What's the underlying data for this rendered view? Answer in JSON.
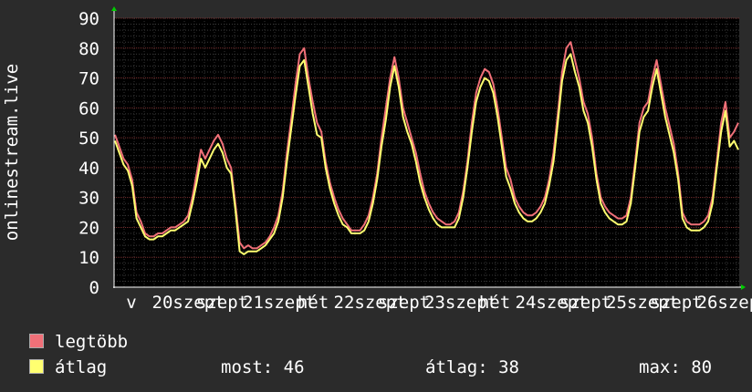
{
  "chart_data": {
    "type": "line",
    "ylabel": "onlinestream.live",
    "ylim": [
      0,
      90
    ],
    "y_ticks": [
      0,
      10,
      20,
      30,
      40,
      50,
      60,
      70,
      80,
      90
    ],
    "x_tick_labels": [
      "v",
      "20",
      "szept",
      "szept",
      "21",
      "szept",
      "hét",
      "22",
      "szept",
      "szept",
      "23",
      "szept",
      "hét",
      "24",
      "szept",
      "szept",
      "25",
      "szept",
      "szept",
      "26",
      "szept"
    ],
    "grid": true,
    "series": [
      {
        "name": "legtöbb",
        "color": "#f07078",
        "values": [
          51,
          47,
          43,
          41,
          36,
          25,
          22,
          18,
          17,
          17,
          18,
          18,
          19,
          20,
          20,
          21,
          22,
          24,
          30,
          38,
          46,
          43,
          46,
          49,
          51,
          48,
          43,
          40,
          28,
          15,
          13,
          14,
          13,
          13,
          14,
          15,
          17,
          20,
          24,
          32,
          45,
          56,
          68,
          78,
          80,
          70,
          62,
          55,
          52,
          42,
          35,
          30,
          26,
          23,
          21,
          19,
          19,
          19,
          21,
          24,
          30,
          38,
          50,
          60,
          70,
          77,
          70,
          60,
          55,
          50,
          45,
          38,
          32,
          28,
          25,
          23,
          22,
          21,
          21,
          22,
          25,
          32,
          42,
          55,
          65,
          70,
          73,
          72,
          68,
          60,
          50,
          40,
          36,
          30,
          27,
          25,
          24,
          24,
          25,
          27,
          30,
          36,
          45,
          58,
          72,
          80,
          82,
          76,
          70,
          62,
          58,
          50,
          38,
          30,
          27,
          25,
          24,
          23,
          23,
          24,
          30,
          42,
          55,
          60,
          62,
          70,
          76,
          68,
          60,
          54,
          48,
          38,
          25,
          22,
          21,
          21,
          21,
          22,
          24,
          30,
          42,
          55,
          62,
          50,
          52,
          55
        ]
      },
      {
        "name": "átlag",
        "color": "#ffff70",
        "values": [
          49,
          45,
          41,
          39,
          34,
          23,
          20,
          17,
          16,
          16,
          17,
          17,
          18,
          19,
          19,
          20,
          21,
          22,
          28,
          35,
          43,
          40,
          43,
          46,
          48,
          45,
          40,
          38,
          26,
          12,
          11,
          12,
          12,
          12,
          13,
          14,
          16,
          18,
          22,
          30,
          42,
          53,
          64,
          74,
          76,
          67,
          58,
          51,
          50,
          40,
          33,
          28,
          24,
          21,
          20,
          18,
          18,
          18,
          19,
          22,
          28,
          36,
          47,
          56,
          67,
          74,
          67,
          57,
          52,
          48,
          42,
          35,
          30,
          26,
          23,
          21,
          20,
          20,
          20,
          20,
          23,
          30,
          40,
          52,
          62,
          67,
          70,
          69,
          65,
          57,
          47,
          37,
          33,
          28,
          25,
          23,
          22,
          22,
          23,
          25,
          28,
          34,
          42,
          55,
          69,
          76,
          78,
          72,
          67,
          59,
          55,
          47,
          36,
          28,
          25,
          23,
          22,
          21,
          21,
          22,
          28,
          40,
          52,
          57,
          59,
          67,
          73,
          65,
          57,
          51,
          45,
          36,
          23,
          20,
          19,
          19,
          19,
          20,
          22,
          28,
          40,
          52,
          59,
          47,
          49,
          46
        ]
      }
    ]
  },
  "legend": {
    "items": [
      {
        "label": "legtöbb",
        "color": "#f07078"
      },
      {
        "label": "átlag",
        "color": "#ffff70"
      }
    ],
    "now_label": "most:",
    "now_value": "46",
    "avg_label": "átlag:",
    "avg_value": "38",
    "max_label": "max:",
    "max_value": "80"
  }
}
